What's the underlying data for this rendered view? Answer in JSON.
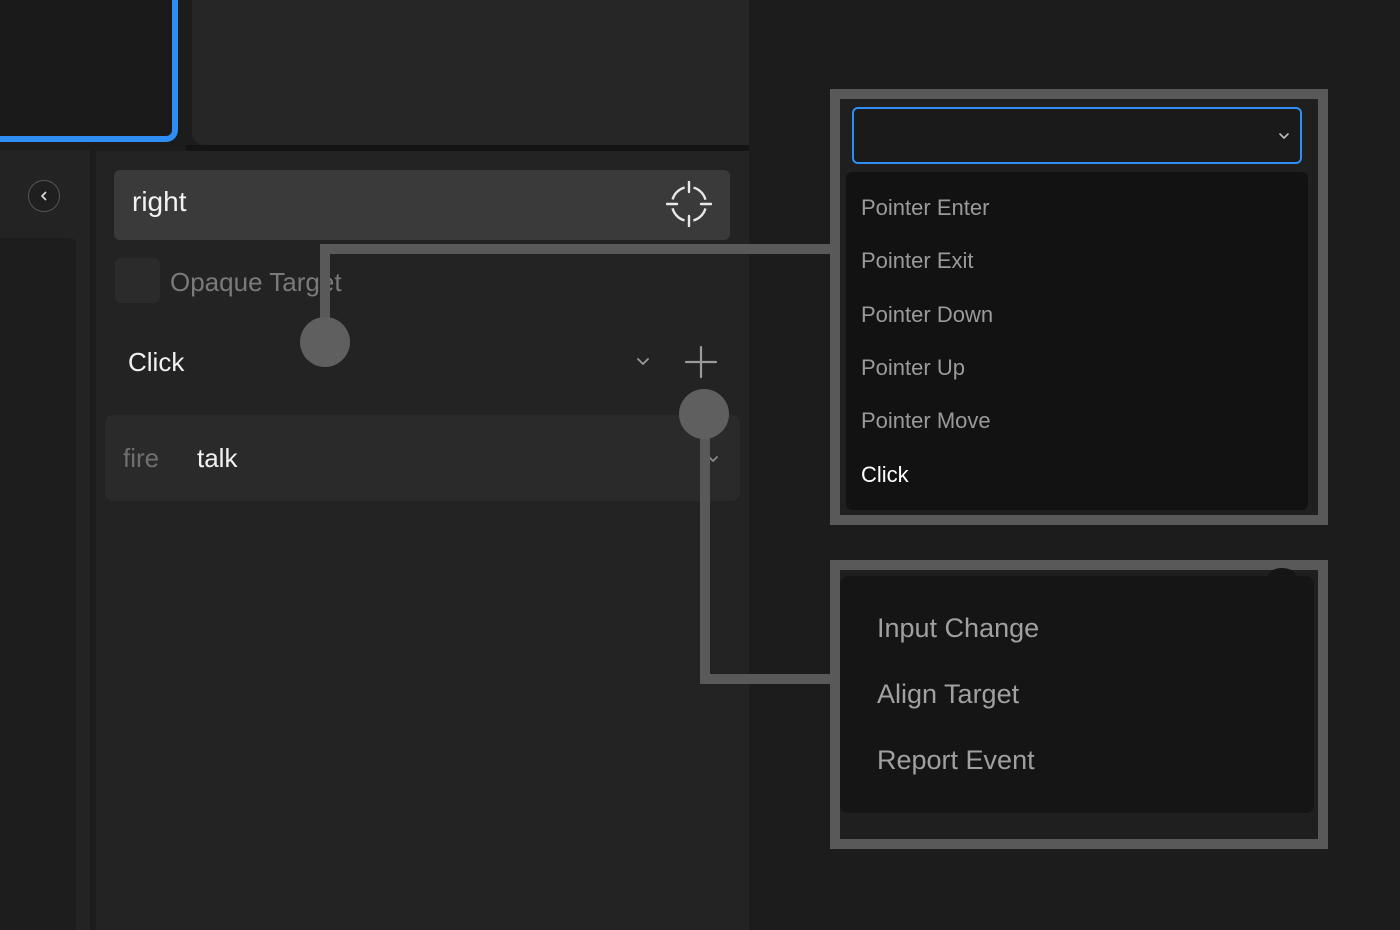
{
  "target": {
    "value": "right",
    "icon": "crosshair-icon"
  },
  "opaque": {
    "label": "Opaque Target",
    "checked": false
  },
  "event": {
    "selected": "Click",
    "chevron_icon": "chevron-down-icon",
    "add_icon": "plus-icon"
  },
  "action": {
    "verb": "fire",
    "target": "talk",
    "chevron_icon": "chevron-down-icon"
  },
  "nav": {
    "back_icon": "chevron-left-icon"
  },
  "event_menu": {
    "selected_value": "",
    "items": [
      "Pointer Enter",
      "Pointer Exit",
      "Pointer Down",
      "Pointer Up",
      "Pointer Move",
      "Click"
    ],
    "selected_item": "Click"
  },
  "action_menu": {
    "items": [
      "Input Change",
      "Align Target",
      "Report Event"
    ]
  },
  "colors": {
    "accent": "#2f8ef4",
    "background": "#1c1c1c",
    "panel": "#232323",
    "callout": "#595959"
  }
}
